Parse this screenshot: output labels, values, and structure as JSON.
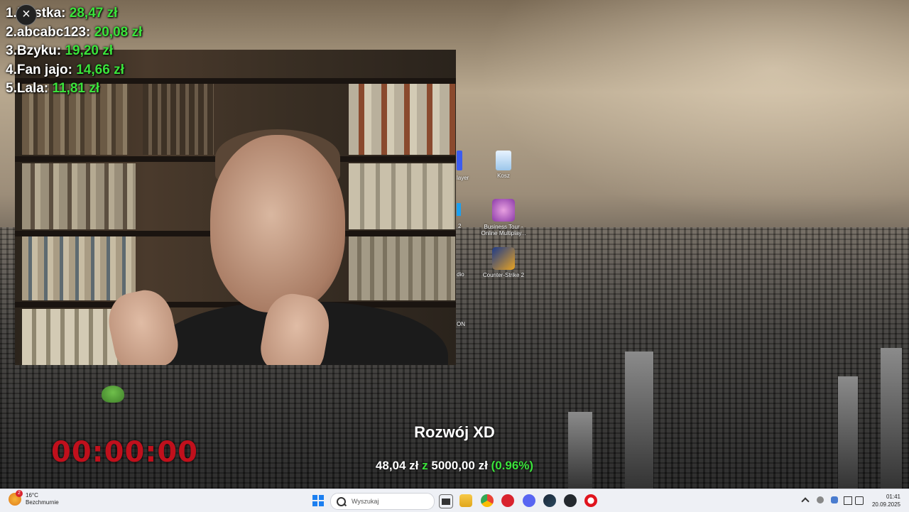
{
  "leaderboard": [
    {
      "rank": "1.",
      "name": "Nastka:",
      "amount": "28,47 zł"
    },
    {
      "rank": "2.",
      "name": "abcabc123:",
      "amount": "20,08 zł"
    },
    {
      "rank": "3.",
      "name": "Bzyku:",
      "amount": "19,20 zł"
    },
    {
      "rank": "4.",
      "name": "Fan jajo:",
      "amount": "14,66 zł"
    },
    {
      "rank": "5.",
      "name": "Lala:",
      "amount": "11,81 zł"
    }
  ],
  "desktop_icons": {
    "recycle_bin": "Kosz",
    "business_tour": "Business Tour - Online Multiplay...",
    "counter_strike": "Counter-Strike 2",
    "partial_labels": [
      "layer",
      "2",
      "dio",
      "ON"
    ]
  },
  "goal": {
    "title": "Rozwój XD",
    "current": "48,04 zł",
    "connector": "z",
    "target": "5000,00 zł",
    "percent": "(0.96%)",
    "progress_fraction": 0.0096
  },
  "timer": "00:00:00",
  "taskbar": {
    "weather_temp": "16°C",
    "weather_desc": "Bezchmurnie",
    "weather_badge": "2",
    "search_placeholder": "Wyszukaj",
    "time": "01:41",
    "date": "20.09.2025",
    "icons": [
      "start-icon",
      "task-view-icon",
      "file-explorer-icon",
      "chrome-icon",
      "app-red-icon",
      "discord-icon",
      "steam-icon",
      "github-icon",
      "opera-icon"
    ]
  },
  "colors": {
    "leaderboard_amount": "#3be33b",
    "timer": "#c0101c",
    "taskbar_bg": "#eef0f5"
  }
}
